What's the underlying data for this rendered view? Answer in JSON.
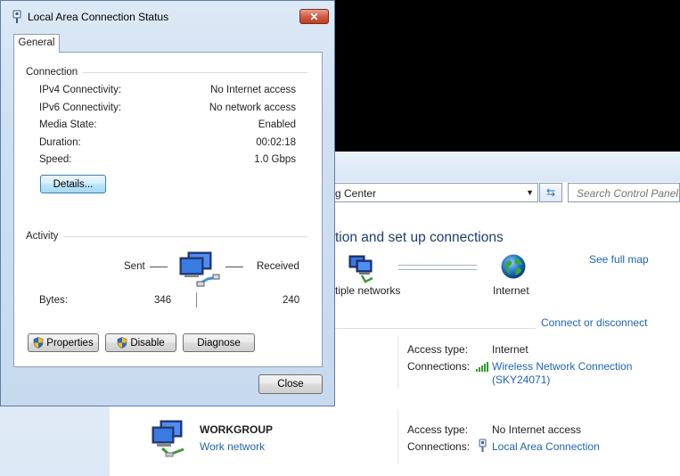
{
  "background_window": {
    "address_text": "g Center",
    "search_placeholder": "Search Control Panel",
    "heading": "tion and set up connections",
    "see_full_map": "See full map",
    "map_left_label": "tiple networks",
    "map_right_label": "Internet",
    "connect_or_disconnect": "Connect or disconnect",
    "networks": [
      {
        "access_type_label": "Access type:",
        "access_type_value": "Internet",
        "connections_label": "Connections:",
        "connection_line1": "Wireless Network Connection",
        "connection_line2": "(SKY24071)"
      },
      {
        "name": "WORKGROUP",
        "network_type": "Work network",
        "access_type_label": "Access type:",
        "access_type_value": "No Internet access",
        "connections_label": "Connections:",
        "connection_line1": "Local Area Connection"
      }
    ]
  },
  "dialog": {
    "title": "Local Area Connection Status",
    "tab": "General",
    "connection_group": "Connection",
    "fields": [
      {
        "label": "IPv4 Connectivity:",
        "value": "No Internet access"
      },
      {
        "label": "IPv6 Connectivity:",
        "value": "No network access"
      },
      {
        "label": "Media State:",
        "value": "Enabled"
      },
      {
        "label": "Duration:",
        "value": "00:02:18"
      },
      {
        "label": "Speed:",
        "value": "1.0 Gbps"
      }
    ],
    "details_button": "Details...",
    "activity_group": "Activity",
    "sent_label": "Sent",
    "received_label": "Received",
    "bytes_label": "Bytes:",
    "bytes_sent": "346",
    "bytes_received": "240",
    "properties_button": "Properties",
    "disable_button": "Disable",
    "diagnose_button": "Diagnose",
    "close_button": "Close"
  },
  "colors": {
    "link": "#1e64b4",
    "heading": "#1e3d6e",
    "close_red": "#c94a31"
  }
}
